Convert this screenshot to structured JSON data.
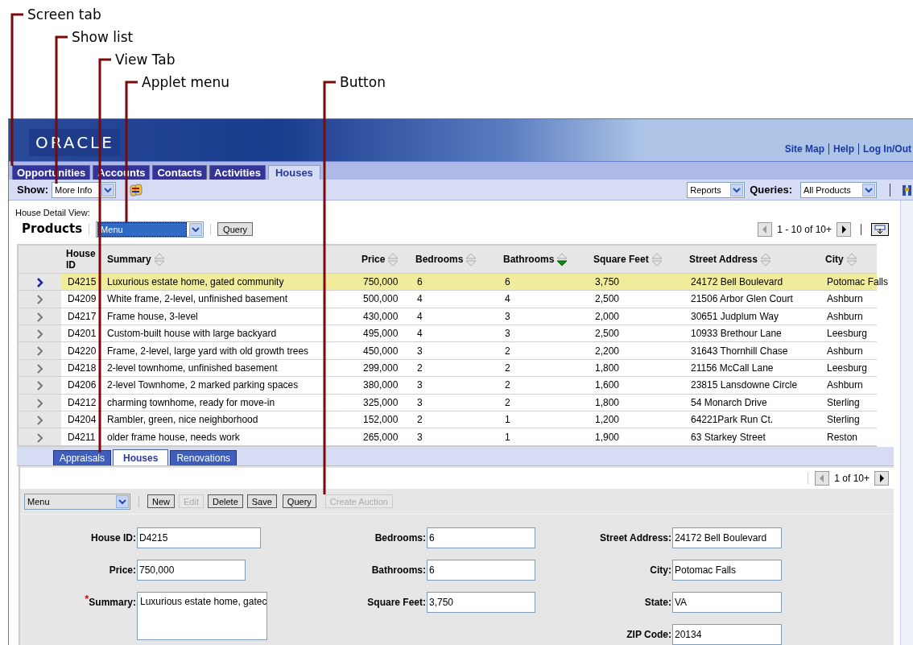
{
  "callouts": [
    {
      "label": "Screen tab"
    },
    {
      "label": "Show list"
    },
    {
      "label": "View Tab"
    },
    {
      "label": "Applet menu"
    },
    {
      "label": "Button"
    }
  ],
  "header": {
    "logo": "ORACLE",
    "links": [
      "Site Map",
      "Help",
      "Log In/Out"
    ]
  },
  "screen_tabs": [
    {
      "label": "Opportunities",
      "selected": false
    },
    {
      "label": "Accounts",
      "selected": false
    },
    {
      "label": "Contacts",
      "selected": false
    },
    {
      "label": "Activities",
      "selected": false
    },
    {
      "label": "Houses",
      "selected": true
    }
  ],
  "show_bar": {
    "show_label": "Show:",
    "show_value": "More Info",
    "reports_value": "Reports",
    "queries_label": "Queries:",
    "queries_value": "All Products"
  },
  "view_title": "House Detail View:",
  "list_applet": {
    "title": "Products",
    "menu": {
      "value": "Menu",
      "highlighted": true
    },
    "query_button": "Query",
    "pager": "1 - 10 of 10+",
    "columns": [
      {
        "label": "House ID",
        "sortable": false,
        "sorted_descending": false
      },
      {
        "label": "Summary",
        "sortable": true,
        "sorted_descending": false
      },
      {
        "label": "Price",
        "sortable": true,
        "sorted_descending": false
      },
      {
        "label": "Bedrooms",
        "sortable": true,
        "sorted_descending": false
      },
      {
        "label": "Bathrooms",
        "sortable": true,
        "sorted_descending": true
      },
      {
        "label": "Square Feet",
        "sortable": true,
        "sorted_descending": false
      },
      {
        "label": "Street Address",
        "sortable": true,
        "sorted_descending": false
      },
      {
        "label": "City",
        "sortable": true,
        "sorted_descending": false
      }
    ],
    "rows": [
      {
        "selected": true,
        "cells": [
          "D4215",
          "Luxurious estate home, gated community",
          "750,000",
          "6",
          "6",
          "3,750",
          "24172 Bell Boulevard",
          "Potomac Falls"
        ]
      },
      {
        "selected": false,
        "cells": [
          "D4209",
          "White frame, 2-level, unfinished basement",
          "500,000",
          "4",
          "4",
          "2,500",
          "21506 Arbor Glen Court",
          "Ashburn"
        ]
      },
      {
        "selected": false,
        "cells": [
          "D4217",
          "Frame house, 3-level",
          "430,000",
          "4",
          "3",
          "2,000",
          "30651 Judplum Way",
          "Ashburn"
        ]
      },
      {
        "selected": false,
        "cells": [
          "D4201",
          "Custom-built house with large backyard",
          "495,000",
          "4",
          "3",
          "2,500",
          "10933 Brethour Lane",
          "Leesburg"
        ]
      },
      {
        "selected": false,
        "cells": [
          "D4220",
          "Frame, 2-level, large yard with old growth trees",
          "450,000",
          "3",
          "2",
          "2,200",
          "31643 Thornhill Chase",
          "Ashburn"
        ]
      },
      {
        "selected": false,
        "cells": [
          "D4218",
          "2-level townhome, unfinished basement",
          "299,000",
          "2",
          "2",
          "1,800",
          "21156 McCall Lane",
          "Leesburg"
        ]
      },
      {
        "selected": false,
        "cells": [
          "D4206",
          "2-level Townhome, 2 marked parking spaces",
          "380,000",
          "3",
          "2",
          "1,600",
          "23815 Lansdowne Circle",
          "Ashburn"
        ]
      },
      {
        "selected": false,
        "cells": [
          "D4212",
          "charming townhome, ready for move-in",
          "325,000",
          "3",
          "2",
          "1,800",
          "54 Monarch Drive",
          "Sterling"
        ]
      },
      {
        "selected": false,
        "cells": [
          "D4204",
          "Rambler, green, nice neighborhood",
          "152,000",
          "2",
          "1",
          "1,200",
          "64221Park Run Ct.",
          "Sterling"
        ]
      },
      {
        "selected": false,
        "cells": [
          "D4211",
          "older frame house, needs work",
          "265,000",
          "3",
          "1",
          "1,900",
          "63 Starkey Street",
          "Reston"
        ]
      }
    ]
  },
  "view_tabs": [
    {
      "label": "Appraisals",
      "selected": false
    },
    {
      "label": "Houses",
      "selected": true
    },
    {
      "label": "Renovations",
      "selected": false
    }
  ],
  "form_applet": {
    "pager": "1 of 10+",
    "menu": {
      "value": "Menu",
      "highlighted": false
    },
    "buttons": [
      {
        "label": "New",
        "disabled": false
      },
      {
        "label": "Edit",
        "disabled": true
      },
      {
        "label": "Delete",
        "disabled": false
      },
      {
        "label": "Save",
        "disabled": false
      },
      {
        "label": "Query",
        "disabled": false
      },
      {
        "label": "Create Auction",
        "disabled": true
      }
    ],
    "field_columns": [
      [
        {
          "label": "House ID:",
          "value": "D4215",
          "kind": "text"
        },
        {
          "label": "Price:",
          "value": "750,000",
          "kind": "text"
        },
        {
          "label": "Summary:",
          "value": "Luxurious estate home, gatec",
          "required_mark": "*",
          "kind": "textarea"
        }
      ],
      [
        {
          "label": "Bedrooms:",
          "value": "6",
          "kind": "text"
        },
        {
          "label": "Bathrooms:",
          "value": "6",
          "kind": "text"
        },
        {
          "label": "Square Feet:",
          "value": "3,750",
          "kind": "text"
        }
      ],
      [
        {
          "label": "Street Address:",
          "value": "24172 Bell Boulevard",
          "kind": "text"
        },
        {
          "label": "City:",
          "value": "Potomac Falls",
          "kind": "text"
        },
        {
          "label": "State:",
          "value": "VA",
          "kind": "text"
        },
        {
          "label": "ZIP Code:",
          "value": "20134",
          "kind": "text"
        }
      ]
    ]
  }
}
